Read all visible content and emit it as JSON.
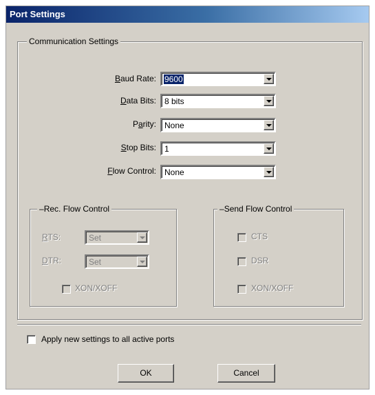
{
  "window": {
    "title": "Port Settings"
  },
  "comm": {
    "group_label": "Communication Settings",
    "baud_rate": {
      "label_u": "B",
      "label_rest": "aud Rate:",
      "value": "9600"
    },
    "data_bits": {
      "label_u": "D",
      "label_rest": "ata Bits:",
      "value": "8 bits"
    },
    "parity": {
      "label_pre": "P",
      "label_u": "a",
      "label_rest": "rity:",
      "value": "None"
    },
    "stop_bits": {
      "label_u": "S",
      "label_rest": "top Bits:",
      "value": "1"
    },
    "flow_control": {
      "label_u": "F",
      "label_rest": "low Control:",
      "value": "None"
    }
  },
  "rec_flow": {
    "group_label": "Rec. Flow Control",
    "rts": {
      "label_u": "R",
      "label_rest": "TS:",
      "value": "Set"
    },
    "dtr": {
      "label_u": "D",
      "label_rest": "TR:",
      "value": "Set"
    },
    "xonxoff_label": "XON/XOFF"
  },
  "send_flow": {
    "group_label": "Send Flow Control",
    "cts_label": "CTS",
    "dsr_label": "DSR",
    "xonxoff_label": "XON/XOFF"
  },
  "apply_all": {
    "label": "Apply new settings to all active ports",
    "checked": false
  },
  "buttons": {
    "ok": "OK",
    "cancel": "Cancel"
  }
}
